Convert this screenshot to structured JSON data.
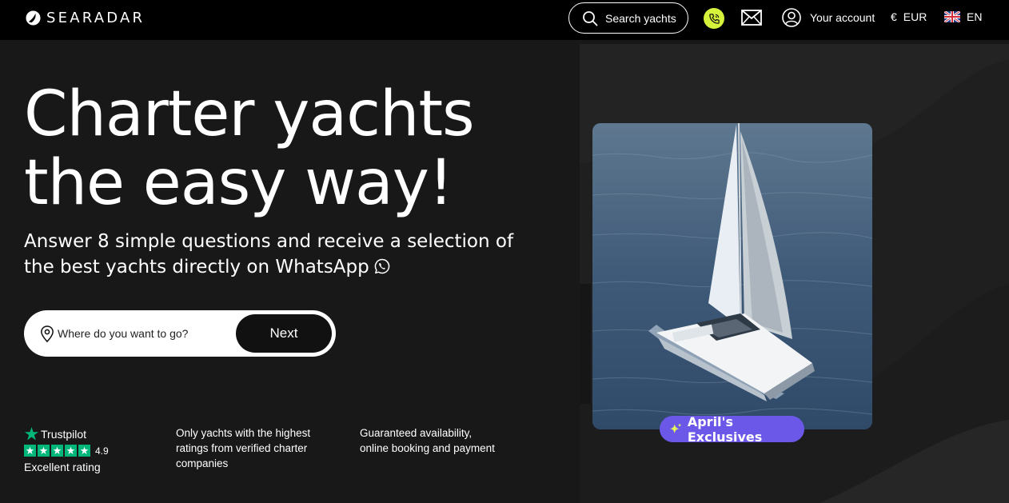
{
  "header": {
    "brand": "SEARADAR",
    "search_label": "Search yachts",
    "account_label": "Your account",
    "currency_symbol": "€",
    "currency": "EUR",
    "language": "EN",
    "phone_button_color": "#d6f23a"
  },
  "hero": {
    "title": "Charter yachts the easy way!",
    "subtitle": "Answer 8 simple questions and receive a selection of the best yachts directly on WhatsApp",
    "search_placeholder": "Where do you want to go?",
    "next_label": "Next"
  },
  "trust": {
    "provider": "Trustpilot",
    "score": "4.9",
    "rating_label": "Excellent rating",
    "stars": 5,
    "star_color": "#00b67a"
  },
  "features": [
    "Only yachts with the highest ratings from verified charter companies",
    "Guaranteed availability, online booking and payment"
  ],
  "promo": {
    "badge_label": "April's Exclusives",
    "badge_color": "#6b58e8"
  },
  "icons": [
    "logo-icon",
    "search-icon",
    "phone-icon",
    "mail-icon",
    "user-icon",
    "uk-flag-icon",
    "whatsapp-icon",
    "location-pin-icon",
    "trustpilot-star-icon",
    "sparkle-icon"
  ]
}
